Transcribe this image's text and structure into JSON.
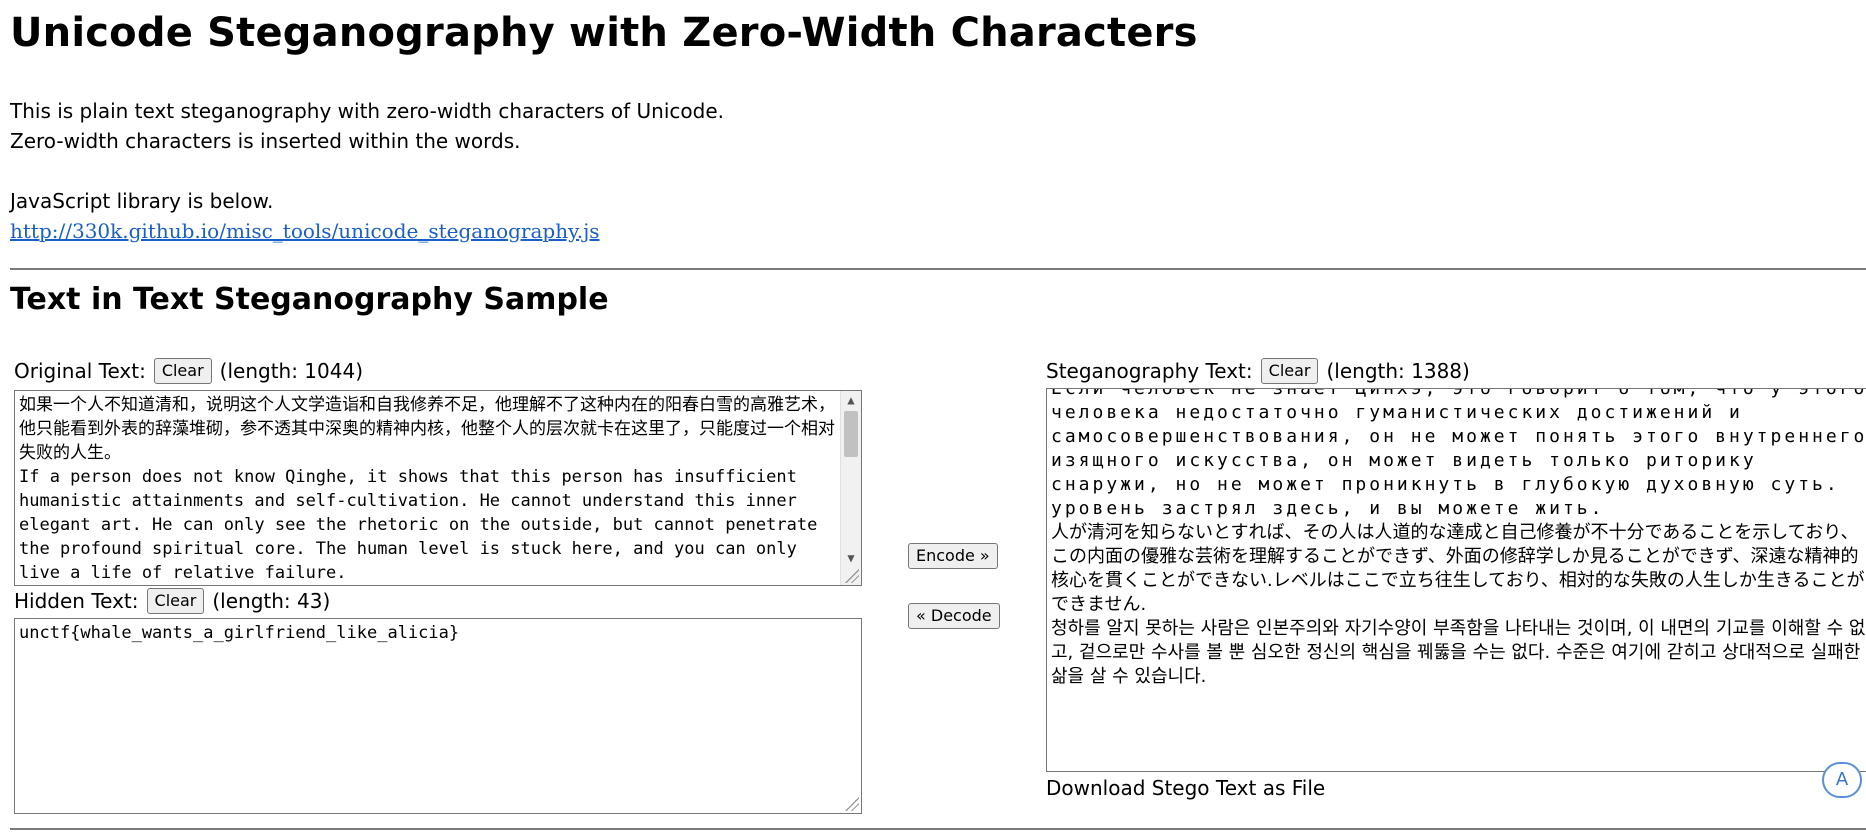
{
  "page": {
    "title": "Unicode Steganography with Zero-Width Characters",
    "intro_line1": "This is plain text steganography with zero-width characters of Unicode.",
    "intro_line2": "Zero-width characters is inserted within the words.",
    "library_label": "JavaScript library is below.",
    "library_link": "http://330k.github.io/misc_tools/unicode_steganography.js",
    "section_title": "Text in Text Steganography Sample"
  },
  "original": {
    "label": "Original Text:",
    "clear_label": "Clear",
    "length_text": "(length: 1044)",
    "text": "如果一个人不知道清和，说明这个人文学造诣和自我修养不足，他理解不了这种内在的阳春白雪的高雅艺术，他只能看到外表的辞藻堆砌，参不透其中深奥的精神内核，他整个人的层次就卡在这里了，只能度过一个相对失败的人生。\nIf a person does not know Qinghe, it shows that this person has insufficient humanistic attainments and self-cultivation. He cannot understand this inner elegant art. He can only see the rhetoric on the outside, but cannot penetrate the profound spiritual core. The human level is stuck here, and you can only live a life of relative failure."
  },
  "hidden": {
    "label": "Hidden Text:",
    "clear_label": "Clear",
    "length_text": "(length: 43)",
    "text": "unctf{whale_wants_a_girlfriend_like_alicia}"
  },
  "actions": {
    "encode_label": "Encode »",
    "decode_label": "« Decode"
  },
  "stego": {
    "label": "Steganography Text:",
    "clear_label": "Clear",
    "length_text": "(length: 1388)",
    "text_russian": "Если человек не знает Цинхэ, это говорит о том, что у этого человека недостаточно гуманистических достижений и самосовершенствования, он не может понять этого внутреннего изящного искусства, он может видеть только риторику снаружи, но не может проникнуть в глубокую духовную суть. уровень застрял здесь, и вы можете жить.",
    "text_japanese": "人が清河を知らないとすれば、その人は人道的な達成と自己修養が不十分であることを示しており、この内面の優雅な芸術を理解することができず、外面の修辞学しか見ることができず、深遠な精神的核心を貫くことができない.レベルはここで立ち往生しており、相対的な失敗の人生しか生きることができません.",
    "text_korean": "청하를 알지 못하는 사람은 인본주의와 자기수양이 부족함을 나타내는 것이며, 이 내면의 기교를 이해할 수 없고, 겉으로만 수사를 볼 뿐 심오한 정신의 핵심을 꿰뚫을 수는 없다. 수준은 여기에 갇히고 상대적으로 실패한 삶을 살 수 있습니다.",
    "download_label": "Download Stego Text as File"
  },
  "overlay": {
    "translate_glyph": "A"
  }
}
